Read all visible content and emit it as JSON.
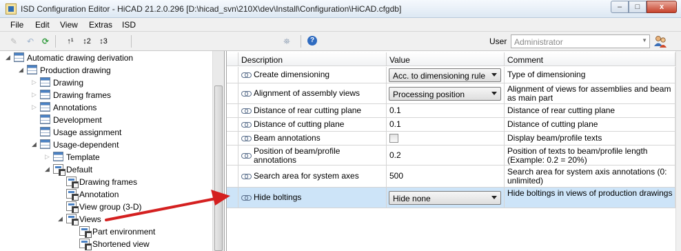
{
  "window": {
    "title": "ISD Configuration Editor  - HiCAD 21.2.0.296 [D:\\hicad_svn\\210X\\dev\\Install\\Configuration\\HiCAD.cfgdb]",
    "buttons": {
      "minimize": "–",
      "maximize": "□",
      "close": "x"
    }
  },
  "menu": [
    "File",
    "Edit",
    "View",
    "Extras",
    "ISD"
  ],
  "toolbar": {
    "icons": [
      "pencil-icon",
      "undo-icon",
      "refresh-icon",
      "sort-up-icon",
      "sort-12-icon",
      "sort-13-icon",
      "binoculars-icon",
      "help-icon"
    ],
    "user_label": "User",
    "user_value": "Administrator"
  },
  "tree": [
    {
      "label": "Automatic drawing derivation",
      "expander": "open",
      "icon": "table"
    },
    {
      "label": "Production drawing",
      "expander": "open",
      "icon": "table"
    },
    {
      "label": "Drawing",
      "expander": "closed",
      "icon": "table"
    },
    {
      "label": "Drawing frames",
      "expander": "closed",
      "icon": "table"
    },
    {
      "label": "Annotations",
      "expander": "closed",
      "icon": "table"
    },
    {
      "label": "Development",
      "expander": "",
      "icon": "table"
    },
    {
      "label": "Usage assignment",
      "expander": "",
      "icon": "table"
    },
    {
      "label": "Usage-dependent",
      "expander": "open",
      "icon": "table"
    },
    {
      "label": "Template",
      "expander": "closed",
      "icon": "table"
    },
    {
      "label": "Default",
      "expander": "open",
      "icon": "view"
    },
    {
      "label": "Drawing frames",
      "expander": "",
      "icon": "view"
    },
    {
      "label": "Annotation",
      "expander": "",
      "icon": "view"
    },
    {
      "label": "View group (3-D)",
      "expander": "",
      "icon": "view"
    },
    {
      "label": "Views",
      "expander": "open",
      "icon": "view"
    },
    {
      "label": "Part environment",
      "expander": "",
      "icon": "view"
    },
    {
      "label": "Shortened view",
      "expander": "",
      "icon": "view"
    }
  ],
  "grid": {
    "headers": [
      "Description",
      "Value",
      "Comment"
    ],
    "rows": [
      {
        "description": "Create dimensioning",
        "value": "Acc. to dimensioning rule",
        "value_type": "combo",
        "comment": "Type of dimensioning"
      },
      {
        "description": "Alignment of assembly views",
        "value": "Processing position",
        "value_type": "combo",
        "comment": "Alignment of views for assemblies and beam as main part"
      },
      {
        "description": "Distance of rear cutting plane",
        "value": "0.1",
        "value_type": "text",
        "comment": "Distance of rear cutting plane"
      },
      {
        "description": "Distance of cutting plane",
        "value": "0.1",
        "value_type": "text",
        "comment": "Distance of cutting plane"
      },
      {
        "description": "Beam annotations",
        "value": "",
        "value_type": "checkbox",
        "comment": "Display beam/profile texts"
      },
      {
        "description": "Position of beam/profile annotations",
        "value": "0.2",
        "value_type": "text",
        "comment": "Position of texts to beam/profile length (Example: 0.2 = 20%)"
      },
      {
        "description": "Search area for system axes",
        "value": "500",
        "value_type": "text",
        "comment": "Search area for system axis annotations (0: unlimited)"
      },
      {
        "description": "Hide boltings",
        "value": "Hide none",
        "value_type": "combo",
        "comment": "Hide boltings in views of production drawings",
        "selected": true
      }
    ]
  },
  "colors": {
    "selection": "#cde4f8",
    "arrow": "#d42020"
  }
}
